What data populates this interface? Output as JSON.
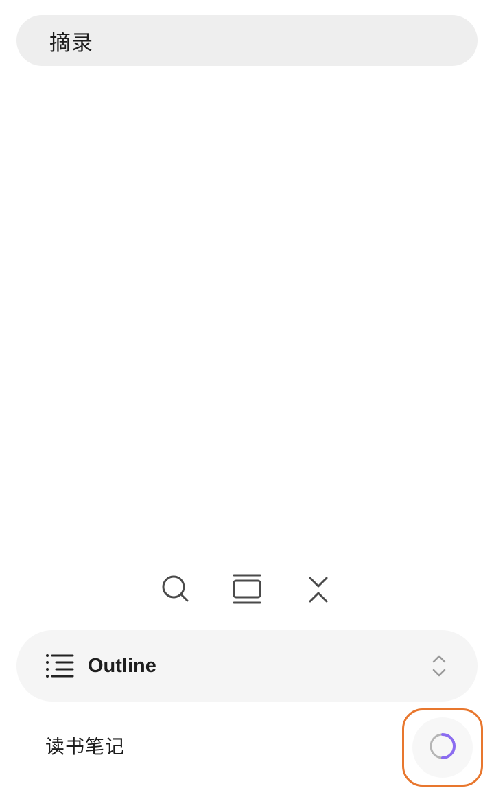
{
  "search": {
    "value": "摘录"
  },
  "toolbar": {
    "items": [
      {
        "icon": "search-icon"
      },
      {
        "icon": "cards-icon"
      },
      {
        "icon": "collapse-icon"
      }
    ]
  },
  "outline": {
    "icon": "list-icon",
    "label": "Outline",
    "toggle_icon": "chevron-updown-icon"
  },
  "note": {
    "title": "读书笔记"
  },
  "sync": {
    "icon": "loading-spinner-icon",
    "accent_color": "#8b6cf0",
    "highlight_color": "#e8772e"
  }
}
